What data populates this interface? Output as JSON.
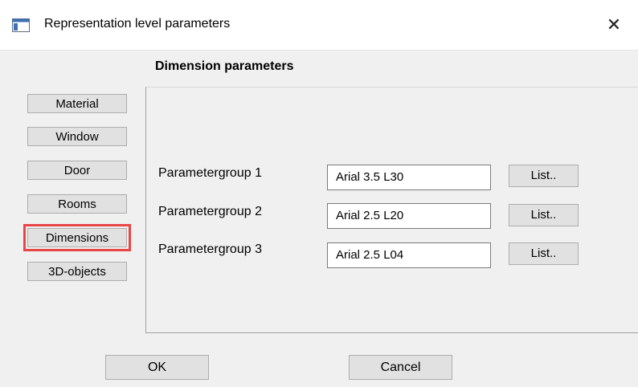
{
  "window": {
    "title": "Representation level parameters",
    "close_glyph": "✕"
  },
  "section": {
    "title": "Dimension parameters"
  },
  "sidebar": {
    "items": [
      {
        "label": "Material"
      },
      {
        "label": "Window"
      },
      {
        "label": "Door"
      },
      {
        "label": "Rooms"
      },
      {
        "label": "Dimensions",
        "selected": true
      },
      {
        "label": "3D-objects"
      }
    ]
  },
  "params": [
    {
      "label": "Parametergroup 1",
      "value": "Arial 3.5 L30",
      "button": "List.."
    },
    {
      "label": "Parametergroup 2",
      "value": "Arial 2.5 L20",
      "button": "List.."
    },
    {
      "label": "Parametergroup 3",
      "value": "Arial 2.5 L04",
      "button": "List.."
    }
  ],
  "footer": {
    "ok_label": "OK",
    "cancel_label": "Cancel"
  },
  "colors": {
    "highlight": "#e84646",
    "button_bg": "#e1e1e1",
    "dialog_bg": "#f0f0f0"
  },
  "icons": {
    "app": "window-icon",
    "close": "close-icon"
  }
}
